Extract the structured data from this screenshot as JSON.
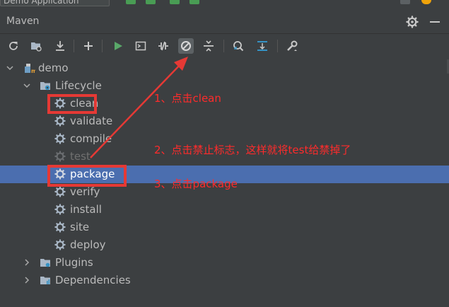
{
  "window": {
    "run_config_label": "Demo Application"
  },
  "panel": {
    "title": "Maven"
  },
  "toolbar": {
    "buttons": [
      {
        "name": "reload-all-icon"
      },
      {
        "name": "generate-sources-icon"
      },
      {
        "name": "download-icon"
      },
      {
        "name": "add-icon"
      },
      {
        "name": "run-icon"
      },
      {
        "name": "execute-goal-icon"
      },
      {
        "name": "toggle-offline-icon"
      },
      {
        "name": "skip-tests-icon",
        "active": true
      },
      {
        "name": "collapse-all-icon"
      },
      {
        "name": "analyze-dependencies-icon"
      },
      {
        "name": "show-dependencies-icon"
      },
      {
        "name": "settings-wrench-icon"
      }
    ]
  },
  "tree": {
    "root": "demo",
    "lifecycle": "Lifecycle",
    "goals": [
      "clean",
      "validate",
      "compile",
      "test",
      "package",
      "verify",
      "install",
      "site",
      "deploy"
    ],
    "disabled_goal_index": 3,
    "selected_goal_index": 4,
    "plugins": "Plugins",
    "dependencies": "Dependencies"
  },
  "annotations": [
    "1、点击clean",
    "2、点击禁止标志，这样就将test给禁掉了",
    "3、点击package"
  ],
  "colors": {
    "background": "#3c3f41",
    "selection": "#4b6eaf",
    "annotation_red": "#ff2b2b",
    "run_green": "#59a869"
  }
}
